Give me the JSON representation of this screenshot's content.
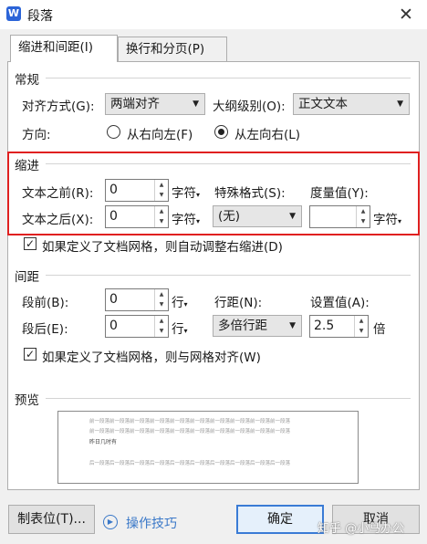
{
  "window": {
    "app_icon": "W",
    "title": "段落",
    "close_icon": "✕"
  },
  "tabs": [
    {
      "label": "缩进和间距(I)",
      "active": true
    },
    {
      "label": "换行和分页(P)",
      "active": false
    }
  ],
  "general": {
    "section_title": "常规",
    "alignment_label": "对齐方式(G):",
    "alignment_value": "两端对齐",
    "outline_label": "大纲级别(O):",
    "outline_value": "正文文本",
    "direction_label": "方向:",
    "direction_rtl": "从右向左(F)",
    "direction_ltr": "从左向右(L)",
    "direction_selected": "ltr"
  },
  "indent": {
    "section_title": "缩进",
    "before_label": "文本之前(R):",
    "before_value": "0",
    "before_unit": "字符",
    "after_label": "文本之后(X):",
    "after_value": "0",
    "after_unit": "字符",
    "special_label": "特殊格式(S):",
    "special_value": "(无)",
    "measure_label": "度量值(Y):",
    "measure_value": "",
    "measure_unit": "字符",
    "auto_adjust_label": "如果定义了文档网格，则自动调整右缩进(D)",
    "auto_adjust_checked": true
  },
  "spacing": {
    "section_title": "间距",
    "before_label": "段前(B):",
    "before_value": "0",
    "before_unit": "行",
    "after_label": "段后(E):",
    "after_value": "0",
    "after_unit": "行",
    "line_label": "行距(N):",
    "line_value": "多倍行距",
    "setting_label": "设置值(A):",
    "setting_value": "2.5",
    "setting_unit": "倍",
    "grid_align_label": "如果定义了文档网格，则与网格对齐(W)",
    "grid_align_checked": true
  },
  "preview": {
    "section_title": "预览",
    "prev_line_1": "前一段落前一段落前一段落前一段落前一段落前一段落前一段落前一段落前一段落前一段落",
    "prev_line_2": "前一段落前一段落前一段落前一段落前一段落前一段落前一段落前一段落前一段落前一段落",
    "sample_text": "昨日几时有",
    "next_line": "后一段落后一段落后一段落后一段落后一段落后一段落后一段落后一段落后一段落后一段落"
  },
  "footer": {
    "tabs_button": "制表位(T)...",
    "tips_link": "操作技巧",
    "ok_button": "确定",
    "cancel_button": "取消",
    "watermark": "知乎 @小马办公"
  }
}
